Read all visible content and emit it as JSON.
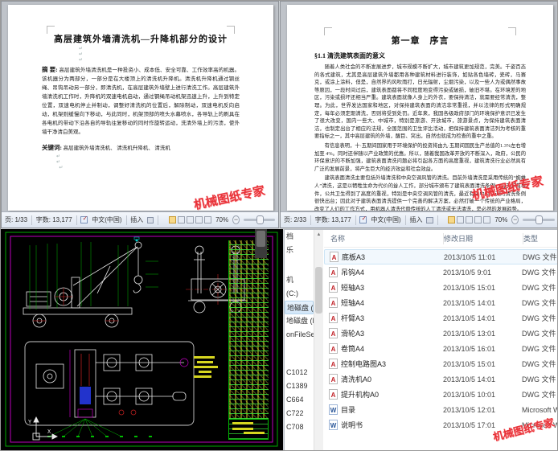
{
  "watermark": {
    "text": "机械图纸专家",
    "color": "#e8333a"
  },
  "doc1": {
    "title": "高层建筑外墙清洗机—升降机部分的设计",
    "abstract_label": "摘  要:",
    "abstract_text": "高层建筑外墙清洗机是一种投资小、成本低、安全可靠、工作效率高的机器。该机器分为两部分，一部分是在大楼顶上的清洗机升降机。清洗机升降机通过钢丝绳、吊钩吊动另一部分，即清洗机，在高层建筑外墙壁上进行清洗工作。高层建筑外墙清洗机工作时，升降机的双速电机启动，通过钢绳吊动机架迅速上升，上升到特定位置，双速电机停止并制动，调整好清洗机的位置后，解除制动，双速电机反向启动，机架则缓慢向下移动，与此同时，机架顶部的喷头水幕喷水，各导轨上的刷具在各电机的带动下沿各自的导轨往复移动的同时作旋转运动，洗清外墙上的污渍，使外墙干净清白美观。",
    "keywords_label": "关键词:",
    "keywords_text": "高层建筑外墙清洗机、   清洗机升降机、   清洗机",
    "statusbar": {
      "page": "页: 1/33",
      "words": "字数: 13,177",
      "lang": "中文(中国)",
      "insert_mode": "插入",
      "zoom": "70%",
      "zoom_out": "−"
    }
  },
  "doc2": {
    "title": "第一章　序言",
    "heading": "§1.1 清洗建筑表面的意义",
    "para1": "随着人类社会的不断发展进步，城市规模不断扩大，城市建筑更加规范，完美。千姿百态的各式建筑，尤其是高层建筑外墙都用各种建筑材料进行装饰，如贴各色墙砖，瓷砖，马赛克，或涂上涂料，但是，自然界的风吹雨打，日光辐射，尘烟污染，以及一些人为或偶然事故等原因，一段时间过后，建筑表面都将不同程度地变得污染或破损，破旧不堪。在环境差的地区，污染或损坏还相当严重。建筑表面就像人身上的外衣，要保持清洁，就需要经常清洗，整理。为此，世界发达国家和地区，对保持建筑表面的清洁非常重视，并以法律的形式明确规定，每年必须定期清洗，否则将受到处罚。近年来，我国各级政府部门的环境保护意识已发生了很大改变，国内一些大、中城市，特别是旅游、开放城市，旅游景点，为保持建筑表面清洁，也制定出台了相应的法规，全国范围的卫生评比活动，把保持建筑表面清洁列为考核的重要指标之一，其中高层建筑的外墙，醒目、突出，自然也就成为检查的重中之重。",
    "para2": "有信息表明，十·五期间国家用于环境保护的投资将由九·五期间国民生产总值的1.3%左右增加至 4%。同时还伴随以产业政策的优惠。所以，随着我国改革开放的不断深入，政府，公民的环保意识的不断加强，建筑表面清洗问题必将引起各方面的高度重视，建筑清洗行业必然具有广泛的发展前景，将产生巨大的经济效益和社会效益。",
    "para3": "建筑表面清洗主要包括外墙清洗和中央空调风管的清洗。目前外墙清洗是采用传统的“蜘蛛人”清洗，这是以牺牲生命为代价的耸人工作，部分城市颁布了建筑表面清洗条例。由于非典事件，公共卫生得到了高度的重视，特别是中央空调风管的清洗，最近有关中央空调的清洗条例很快出台；因此对于建筑表面清洗提供一个完善的解决方案，必然打破一个传统的产业格局，改变了人们的工作方式，用机器人清洗代替传统的人工清洗或无法清洗，是必然的发展趋势。",
    "statusbar": {
      "page": "页: 2/33",
      "words": "字数: 13,177",
      "lang": "中文(中国)",
      "insert_mode": "插入",
      "zoom": "70%",
      "zoom_out": "−"
    }
  },
  "cad": {
    "bg": "#000000",
    "frame_outer": "#00aa00",
    "frame_inner": "#bb00bb",
    "geometry": "#e8e8e8",
    "centerline": "#cc2222",
    "dimension": "#00bb00",
    "annotation": "#d6d620"
  },
  "explorer": {
    "columns": {
      "name": "名称",
      "date": "修改日期",
      "type": "类型"
    },
    "sidebar": [
      {
        "label": "档"
      },
      {
        "label": "乐"
      },
      {
        "label": "机"
      },
      {
        "label": "(C:)"
      },
      {
        "label": "地磁盘 (D:)"
      },
      {
        "label": "地磁盘 (E:)"
      },
      {
        "label": "onFileServer"
      },
      {
        "label": "C1012"
      },
      {
        "label": "C1389"
      },
      {
        "label": "C664"
      },
      {
        "label": "C722"
      },
      {
        "label": "C708"
      }
    ],
    "files": [
      {
        "name": "底板A3",
        "date": "2013/10/5 11:01",
        "type": "DWG 文件"
      },
      {
        "name": "吊钩A4",
        "date": "2013/10/5 9:01",
        "type": "DWG 文件"
      },
      {
        "name": "短轴A3",
        "date": "2013/10/5 15:01",
        "type": "DWG 文件"
      },
      {
        "name": "短轴A4",
        "date": "2013/10/5 14:01",
        "type": "DWG 文件"
      },
      {
        "name": "杆臂A3",
        "date": "2013/10/5 14:01",
        "type": "DWG 文件"
      },
      {
        "name": "滑轮A3",
        "date": "2013/10/5 13:01",
        "type": "DWG 文件"
      },
      {
        "name": "卷筒A4",
        "date": "2013/10/5 16:01",
        "type": "DWG 文件"
      },
      {
        "name": "控制电路图A3",
        "date": "2013/10/5 15:01",
        "type": "DWG 文件"
      },
      {
        "name": "清洗机A0",
        "date": "2013/10/5 14:01",
        "type": "DWG 文件"
      },
      {
        "name": "提升机构A0",
        "date": "2013/10/5 10:01",
        "type": "DWG 文件"
      },
      {
        "name": "目录",
        "date": "2013/10/5 12:01",
        "type": "Microsoft W"
      },
      {
        "name": "说明书",
        "date": "2013/10/5 17:01",
        "type": "Microsoft W"
      }
    ],
    "icons": {
      "dwg": "A",
      "word": "W",
      "scroll_up": "▲",
      "scroll_down": "▼"
    }
  }
}
